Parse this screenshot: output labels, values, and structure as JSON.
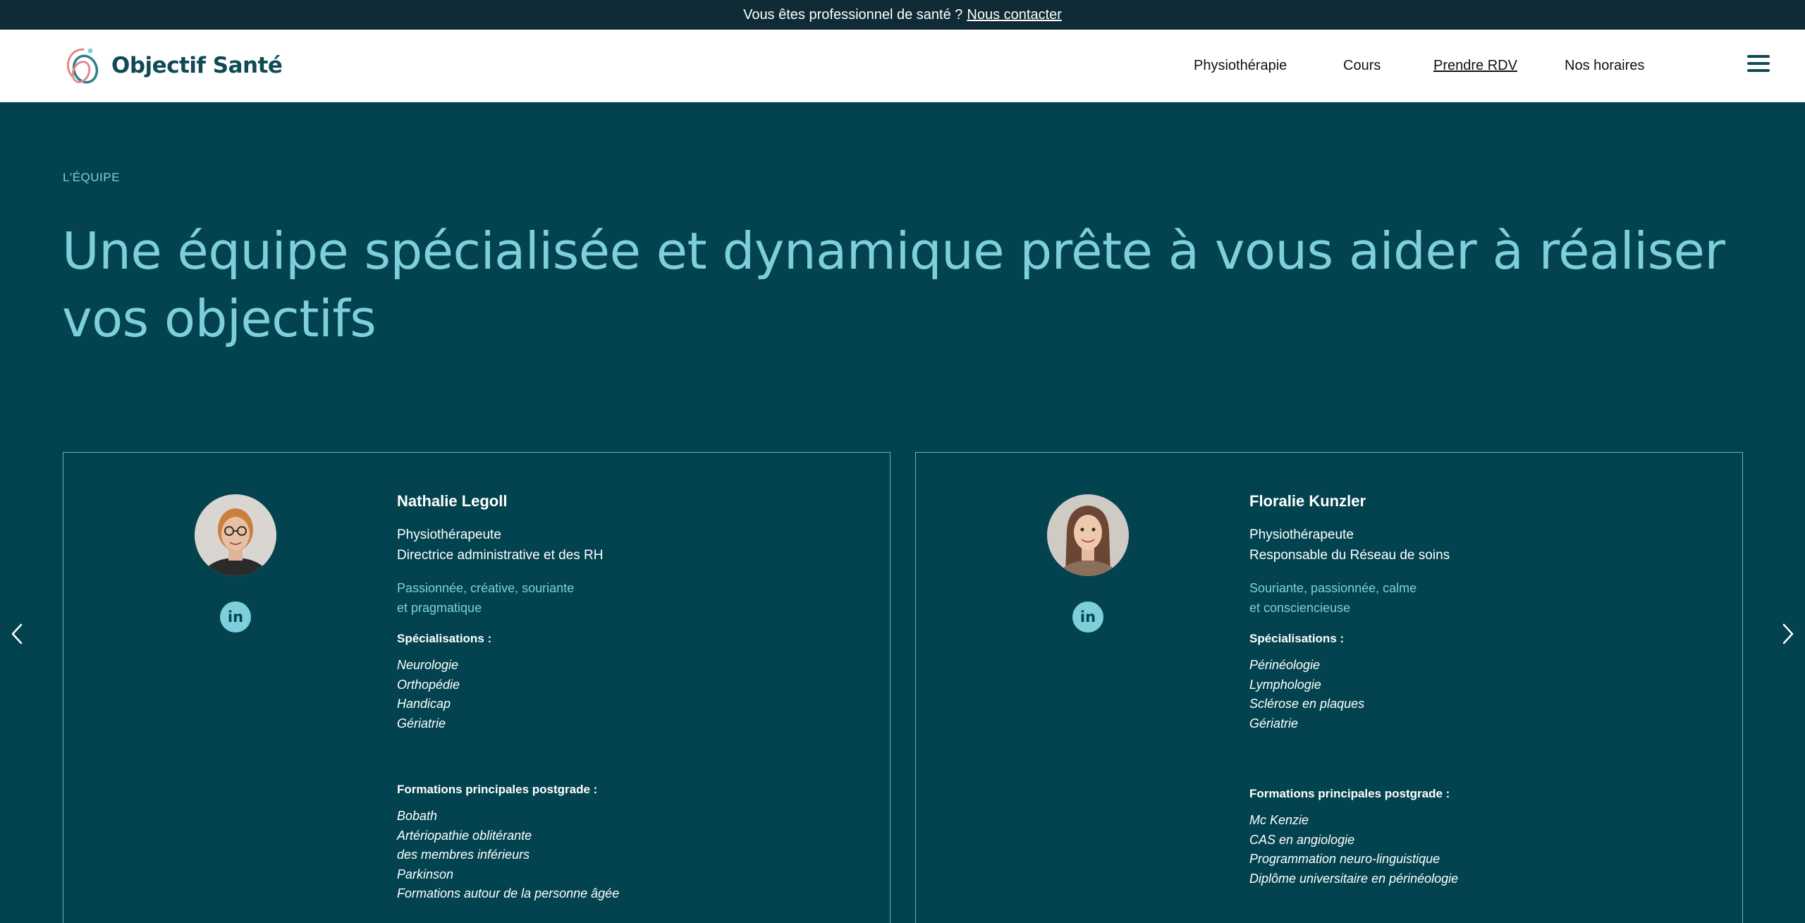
{
  "topbar": {
    "text": "Vous êtes professionnel de santé ?",
    "link": "Nous contacter"
  },
  "brand": {
    "name": "Objectif Santé",
    "logo_icon": "objectif-sante-logo-icon",
    "color": "#0f4a55",
    "accent": "#e48a8a"
  },
  "nav": {
    "items": [
      {
        "label": "Physiothérapie"
      },
      {
        "label": "Cours"
      },
      {
        "label": "Prendre RDV"
      },
      {
        "label": "Nos horaires"
      }
    ],
    "menu_icon": "hamburger-menu-icon"
  },
  "section": {
    "eyebrow": "L'ÉQUIPE",
    "headline": "Une équipe spécialisée et dynamique prête à vous aider à réaliser vos objectifs"
  },
  "team": [
    {
      "name": "Nathalie Legoll",
      "roles": [
        "Physiothérapeute",
        "Directrice administrative et des RH"
      ],
      "traits": [
        "Passionnée, créative, souriante",
        "et pragmatique"
      ],
      "specialisations_title": "Spécialisations :",
      "specialisations": [
        "Neurologie",
        "Orthopédie",
        "Handicap",
        "Gériatrie"
      ],
      "formations_title": "Formations principales postgrade :",
      "formations": [
        "Bobath",
        "Artériopathie oblitérante",
        "des membres inférieurs",
        "Parkinson",
        "Formations autour de la personne âgée"
      ],
      "linkedin": "in"
    },
    {
      "name": "Floralie Kunzler",
      "roles": [
        "Physiothérapeute",
        "Responsable du Réseau de soins"
      ],
      "traits": [
        "Souriante, passionnée, calme",
        "et consciencieuse"
      ],
      "specialisations_title": "Spécialisations :",
      "specialisations": [
        "Périnéologie",
        "Lymphologie",
        "Sclérose en plaques",
        "Gériatrie"
      ],
      "formations_title": "Formations principales postgrade :",
      "formations": [
        "Mc Kenzie",
        "CAS en angiologie",
        "Programmation neuro-linguistique",
        "Diplôme universitaire en périnéologie"
      ],
      "linkedin": "in"
    }
  ],
  "carousel": {
    "prev_icon": "chevron-left-icon",
    "next_icon": "chevron-right-icon"
  },
  "colors": {
    "background": "#03434f",
    "accent": "#7ecfdc",
    "topbar": "#0f2b35"
  }
}
